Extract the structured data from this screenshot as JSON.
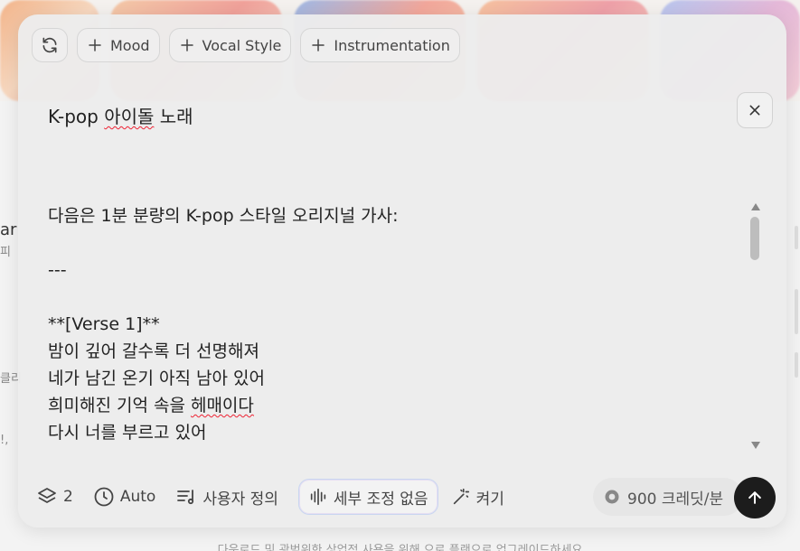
{
  "background": {
    "side_texts": [
      "ar",
      "피",
      "클리",
      "!,"
    ],
    "bottom_text": "다운로드 및 광범위한 상업적 사용을 위해 으로 플랜으로 업그레이드하세요"
  },
  "chips": {
    "refresh_icon": "refresh-icon",
    "mood_label": "Mood",
    "vocal_style_label": "Vocal Style",
    "instrumentation_label": "Instrumentation"
  },
  "prompt": {
    "title_prefix": "K-pop ",
    "title_squiggle": "아이돌",
    "title_suffix": " 노래"
  },
  "lyrics": {
    "intro": "다음은 1분 분량의 K-pop 스타일 오리지널 가사:",
    "separator": "---",
    "verse_header": "**[Verse 1]**",
    "line1": "밤이 깊어 갈수록 더 선명해져",
    "line2": "네가 남긴 온기 아직 남아 있어",
    "line3_prefix": "희미해진 기억 속을 ",
    "line3_squiggle": "헤매이다",
    "line4": "다시 너를 부르고 있어"
  },
  "toolbar": {
    "layers_count": "2",
    "auto_label": "Auto",
    "custom_label": "사용자 정의",
    "fine_tune_label": "세부 조정 없음",
    "enhance_label": "켜기",
    "credits_label": "900 크레딧/분"
  },
  "colors": {
    "send_button": "#1c1c1c",
    "modal_bg": "#ececec"
  }
}
